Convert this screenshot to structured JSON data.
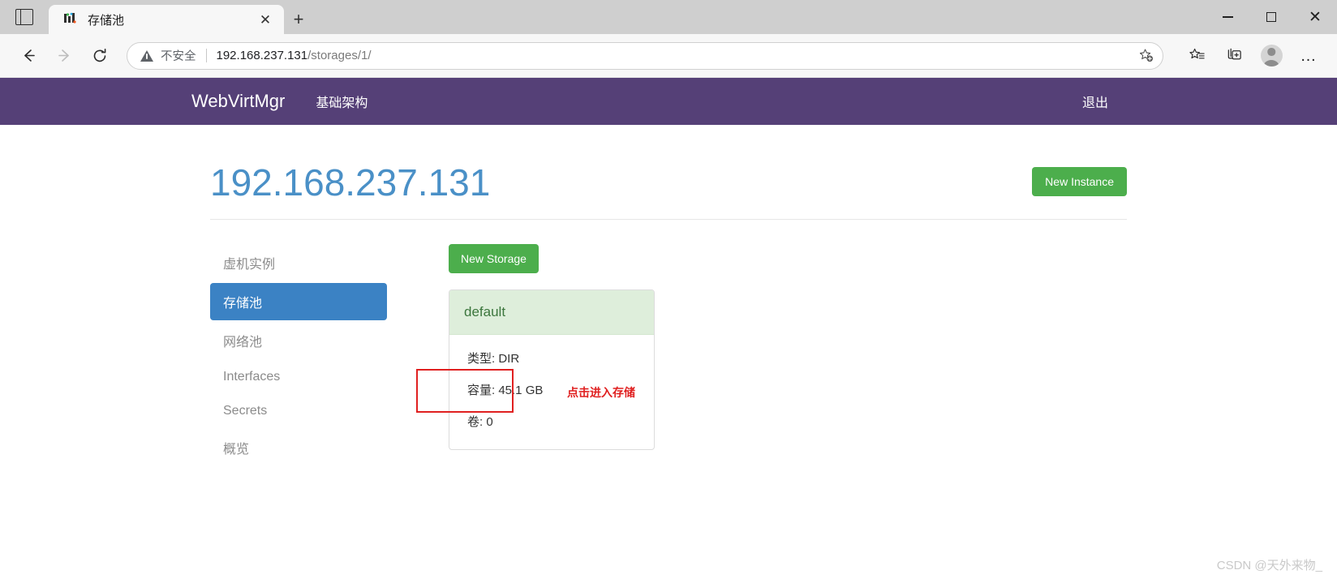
{
  "browser": {
    "tab": {
      "title": "存储池",
      "favicon": "webvirtmgr-favicon",
      "close_label": "✕"
    },
    "new_tab_label": "+",
    "tab_list_icon": "tab-list-icon",
    "window_controls": {
      "minimize": "─",
      "maximize": "□",
      "close": "✕"
    },
    "nav": {
      "back": "←",
      "forward": "→",
      "reload": "⟳"
    },
    "omnibox": {
      "security_label": "不安全",
      "separator": "|",
      "url_host": "192.168.237.131",
      "url_path": "/storages/1/",
      "favorite_icon": "star-add-icon"
    },
    "toolbar_icons": {
      "favorites": "favorites-list-icon",
      "collections": "collections-add-icon",
      "profile": "profile-avatar-icon",
      "settings": "…"
    }
  },
  "navbar": {
    "brand": "WebVirtMgr",
    "links": [
      {
        "label": "基础架构"
      }
    ],
    "logout": "退出",
    "bg_color": "#554077"
  },
  "header": {
    "title": "192.168.237.131",
    "title_color": "#4a90c7",
    "new_instance_button": "New Instance",
    "button_color": "#4cae4c"
  },
  "sidebar": {
    "items": [
      {
        "label": "虚机实例",
        "active": false
      },
      {
        "label": "存储池",
        "active": true
      },
      {
        "label": "网络池",
        "active": false
      },
      {
        "label": "Interfaces",
        "active": false
      },
      {
        "label": "Secrets",
        "active": false
      },
      {
        "label": "概览",
        "active": false
      }
    ],
    "active_color": "#3b82c4"
  },
  "content": {
    "new_storage_button": "New Storage",
    "storage_card": {
      "name": "default",
      "header_bg": "#deeedb",
      "header_color": "#3c763d",
      "rows": [
        {
          "label": "类型:",
          "value": "DIR"
        },
        {
          "label": "容量:",
          "value": "45.1 GB"
        },
        {
          "label": "卷:",
          "value": "0"
        }
      ],
      "type_line": "类型: DIR",
      "capacity_line": "容量: 45.1 GB",
      "volumes_line": "卷: 0"
    }
  },
  "annotation": {
    "callout_text": "点击进入存储",
    "callout_color": "#e02020",
    "highlight_box": "red-rectangle-highlight"
  },
  "watermark": {
    "text": "CSDN @天外来物_"
  }
}
